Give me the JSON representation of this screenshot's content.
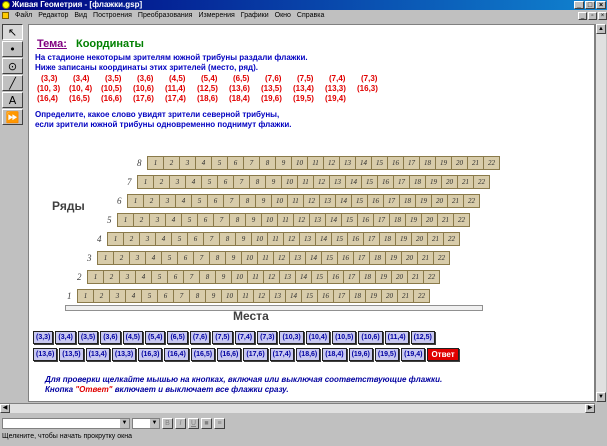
{
  "window": {
    "title": "Живая Геометрия - [флажки.gsp]"
  },
  "menu": [
    "Файл",
    "Редактор",
    "Вид",
    "Построения",
    "Преобразования",
    "Измерения",
    "Графики",
    "Окно",
    "Справка"
  ],
  "topic": {
    "label": "Тема:",
    "value": "Координаты"
  },
  "intro": [
    "На стадионе некоторым зрителям южной трибуны раздали флажки.",
    "Ниже записаны координаты этих зрителей (место, ряд)."
  ],
  "coords": [
    [
      "(3,3)",
      "(3,4)",
      "(3,5)",
      "(3,6)",
      "(4,5)",
      "(5,4)",
      "(6,5)",
      "(7,6)",
      "(7,5)",
      "(7,4)",
      "(7,3)"
    ],
    [
      "(10, 3)",
      "(10, 4)",
      "(10,5)",
      "(10,6)",
      "(11,4)",
      "(12,5)",
      "(13,6)",
      "(13,5)",
      "(13,4)",
      "(13,3)",
      "(16,3)"
    ],
    [
      "(16,4)",
      "(16,5)",
      "(16,6)",
      "(17,6)",
      "(17,4)",
      "(18,6)",
      "(18,4)",
      "(19,6)",
      "(19,5)",
      "(19,4)"
    ]
  ],
  "question": [
    "Определите, какое слово увидят зрители северной трибуны,",
    "если зрители южной трибуны одновременно поднимут флажки."
  ],
  "stadium": {
    "rows_label": "Ряды",
    "seats_label": "Места",
    "row_numbers": [
      "1",
      "2",
      "3",
      "4",
      "5",
      "6",
      "7",
      "8"
    ]
  },
  "flag_buttons": {
    "row1": [
      "(3,3)",
      "(3,4)",
      "(3,5)",
      "(3,6)",
      "(4,5)",
      "(5,4)",
      "(6,5)",
      "(7,6)",
      "(7,5)",
      "(7,4)",
      "(7,3)",
      "(10,3)",
      "(10,4)",
      "(10,5)",
      "(10,6)",
      "(11,4)",
      "(12,5)"
    ],
    "row2": [
      "(13,6)",
      "(13,5)",
      "(13,4)",
      "(13,3)",
      "(16,3)",
      "(16,4)",
      "(16,5)",
      "(16,6)",
      "(17,6)",
      "(17,4)",
      "(18,6)",
      "(18,4)",
      "(19,6)",
      "(19,5)",
      "(19,4)"
    ],
    "answer": "Ответ"
  },
  "hint": {
    "line1": "Для проверки щелкайте мышью на кнопках, включая или выключая соответствующие флажки.",
    "line2_a": "Кнопка ",
    "line2_b": "\"Ответ\"",
    "line2_c": " включает и выключает все флажки сразу."
  },
  "status": "Щелкните, чтобы начать прокрутку окна"
}
